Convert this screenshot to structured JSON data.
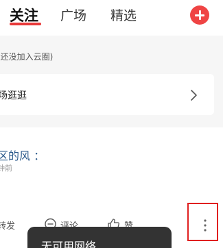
{
  "tabs": [
    {
      "label": "关注",
      "active": true
    },
    {
      "label": "广场",
      "active": false
    },
    {
      "label": "精选",
      "active": false
    }
  ],
  "header": {
    "add_icon": "plus-circle-icon",
    "accent_color": "#ef4444"
  },
  "hint": {
    "text": "(还没加入云圈)"
  },
  "browse": {
    "label": "场逛逛",
    "icon": "chevron-right-icon"
  },
  "post": {
    "author": "区的风 ：",
    "time": "钟前",
    "actions": [
      {
        "label": "转发",
        "icon": "repost-icon"
      },
      {
        "label": "评论",
        "icon": "comment-icon"
      },
      {
        "label": "赞",
        "icon": "thumbs-up-icon"
      }
    ],
    "more_icon": "more-vertical-icon"
  },
  "toast": {
    "text": "无可用网络"
  }
}
